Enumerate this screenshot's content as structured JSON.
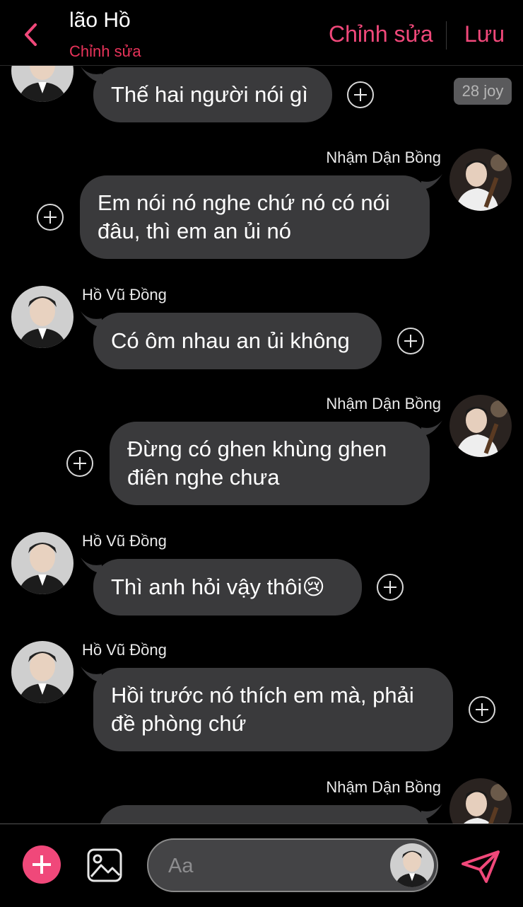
{
  "header": {
    "title": "lão Hồ",
    "subtitle": "Chỉnh sửa",
    "edit_label": "Chỉnh sửa",
    "save_label": "Lưu"
  },
  "first": {
    "text": "Thế hai người nói gì",
    "badge": "28 joy"
  },
  "messages": [
    {
      "sender": "Nhậm Dận Bồng",
      "text": "Em nói nó nghe chứ nó có nói\nđâu, thì em an ủi nó"
    },
    {
      "sender": "Hồ Vũ Đồng",
      "text": "Có ôm nhau an ủi không"
    },
    {
      "sender": "Nhậm Dận Bồng",
      "text": "Đừng có ghen khùng ghen\nđiên nghe chưa"
    },
    {
      "sender": "Hồ Vũ Đồng",
      "text": "Thì anh hỏi vậy thôi😢"
    },
    {
      "sender": "Hồ Vũ Đồng",
      "text": "Hồi trước nó thích em mà, phải\nđề phòng chứ"
    },
    {
      "sender": "Nhậm Dận Bồng",
      "text": ""
    }
  ],
  "composer": {
    "placeholder": "Aa"
  },
  "colors": {
    "accent": "#f0487a",
    "bubble": "#3a3a3c",
    "background": "#000000"
  },
  "icons": [
    "back-chevron-icon",
    "add-reaction-icon",
    "plus-icon",
    "image-icon",
    "send-icon"
  ]
}
